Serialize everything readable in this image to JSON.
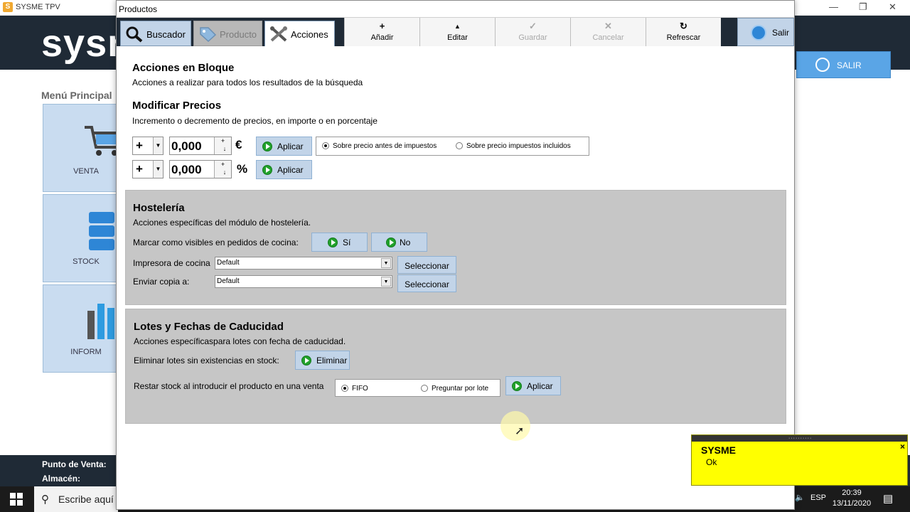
{
  "bg": {
    "app_title": "SYSME TPV",
    "app_icon": "S",
    "window_controls": [
      "—",
      "❐",
      "✕"
    ],
    "logo": "sysn",
    "salir_label": "SALIR",
    "menu_title": "Menú Principal",
    "tiles": [
      "VENTA",
      "STOCK",
      "INFORM"
    ],
    "footer": {
      "pos_label": "Punto de Venta:",
      "almacen_label": "Almacén:"
    }
  },
  "taskbar": {
    "search_placeholder": "Escribe aquí",
    "lang": "ESP",
    "time": "20:39",
    "date": "13/11/2020"
  },
  "modal": {
    "title": "Productos",
    "tabs": [
      {
        "label": "Buscador",
        "icon": "magnifier-icon"
      },
      {
        "label": "Producto",
        "icon": "tag-icon"
      },
      {
        "label": "Acciones",
        "icon": "tools-icon"
      }
    ],
    "toolbar": [
      {
        "glyph": "+",
        "label": "Añadir",
        "enabled": true
      },
      {
        "glyph": "▲",
        "label": "Editar",
        "enabled": true
      },
      {
        "glyph": "✓",
        "label": "Guardar",
        "enabled": false
      },
      {
        "glyph": "✕",
        "label": "Cancelar",
        "enabled": false
      },
      {
        "glyph": "↻",
        "label": "Refrescar",
        "enabled": true
      }
    ],
    "salir_label": "Salir"
  },
  "bloque": {
    "title": "Acciones en Bloque",
    "subtitle": "Acciones a realizar para todos los resultados de la búsqueda"
  },
  "precios": {
    "title": "Modificar Precios",
    "subtitle": "Incremento o decremento de precios, en importe o en porcentaje",
    "row1": {
      "sign": "+",
      "value": "0,000",
      "unit": "€",
      "apply": "Aplicar"
    },
    "row2": {
      "sign": "+",
      "value": "0,000",
      "unit": "%",
      "apply": "Aplicar"
    },
    "radio_before": "Sobre precio antes de impuestos",
    "radio_after": "Sobre precio impuestos incluidos",
    "selected": "before"
  },
  "hosteleria": {
    "title": "Hostelería",
    "subtitle": "Acciones específicas del módulo de hostelería.",
    "visible_label": "Marcar como visibles en pedidos de cocina:",
    "si": "Sí",
    "no": "No",
    "printer_label": "Impresora de cocina",
    "printer_value": "Default",
    "copy_label": "Enviar copia a:",
    "copy_value": "Default",
    "select_btn": "Seleccionar"
  },
  "lotes": {
    "title": "Lotes y Fechas de Caducidad",
    "subtitle": "Acciones específicaspara lotes con fecha de caducidad.",
    "delete_label": "Eliminar lotes sin existencias en stock:",
    "delete_btn": "Eliminar",
    "stock_label": "Restar stock al introducir el producto en una venta",
    "radio_fifo": "FIFO",
    "radio_ask": "Preguntar por lote",
    "selected": "fifo",
    "apply": "Aplicar"
  },
  "toast": {
    "grip": "··········",
    "title": "SYSME",
    "message": "Ok",
    "close": "×"
  },
  "colors": {
    "header_dark": "#1f2a36",
    "button_blue": "#c2d4e8",
    "panel_gray": "#c6c6c6",
    "toast_yellow": "#ffff00",
    "go_green": "#21a12b"
  }
}
